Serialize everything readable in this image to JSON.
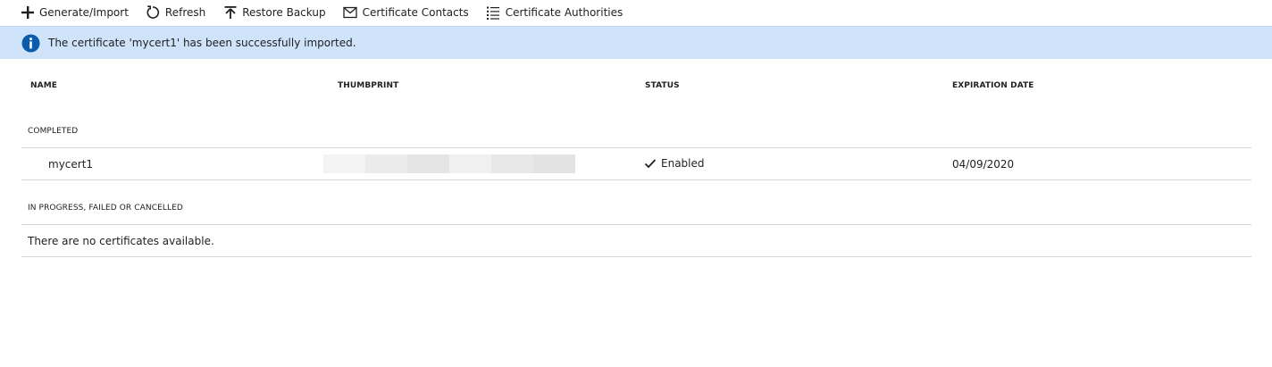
{
  "toolbar": {
    "items": [
      {
        "label": "Generate/Import",
        "icon": "plus-icon"
      },
      {
        "label": "Refresh",
        "icon": "refresh-icon"
      },
      {
        "label": "Restore Backup",
        "icon": "upload-icon"
      },
      {
        "label": "Certificate Contacts",
        "icon": "mail-icon"
      },
      {
        "label": "Certificate Authorities",
        "icon": "list-icon"
      }
    ]
  },
  "banner": {
    "message": "The certificate 'mycert1' has been successfully imported.",
    "icon": "info-icon",
    "color": "#cfe4fa"
  },
  "table": {
    "columns": [
      "NAME",
      "THUMBPRINT",
      "STATUS",
      "EXPIRATION DATE"
    ],
    "groups": [
      {
        "label": "COMPLETED",
        "rows": [
          {
            "name": "mycert1",
            "thumbprint": "",
            "status": "Enabled",
            "expiration": "04/09/2020"
          }
        ]
      },
      {
        "label": "IN PROGRESS, FAILED OR CANCELLED",
        "empty_message": "There are no certificates available."
      }
    ]
  }
}
